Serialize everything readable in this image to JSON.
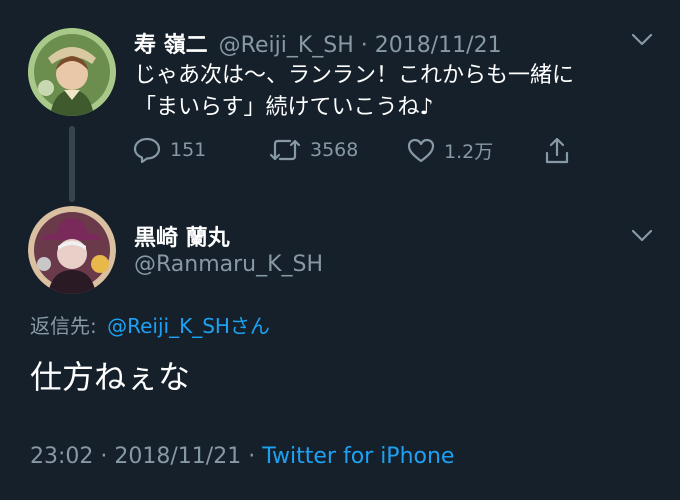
{
  "tweet1": {
    "name": "寿 嶺二",
    "handle": "@Reiji_K_SH",
    "sep": "·",
    "date": "2018/11/21",
    "line1": "じゃあ次は〜、ランラン！これからも一緒に",
    "line2": "「まいらす」続けていこうね♪",
    "replies": "151",
    "retweets": "3568",
    "likes": "1.2万"
  },
  "tweet2": {
    "name": "黒崎 蘭丸",
    "handle": "@Ranmaru_K_SH",
    "reply_prefix": "返信先:",
    "reply_to": "@Reiji_K_SHさん",
    "body": "仕方ねぇな",
    "time": "23:02",
    "sep": "·",
    "date": "2018/11/21",
    "sep2": "·",
    "client": "Twitter for iPhone"
  },
  "icons": [
    "reply-icon",
    "retweet-icon",
    "like-icon",
    "share-icon",
    "chevron-down-icon"
  ]
}
